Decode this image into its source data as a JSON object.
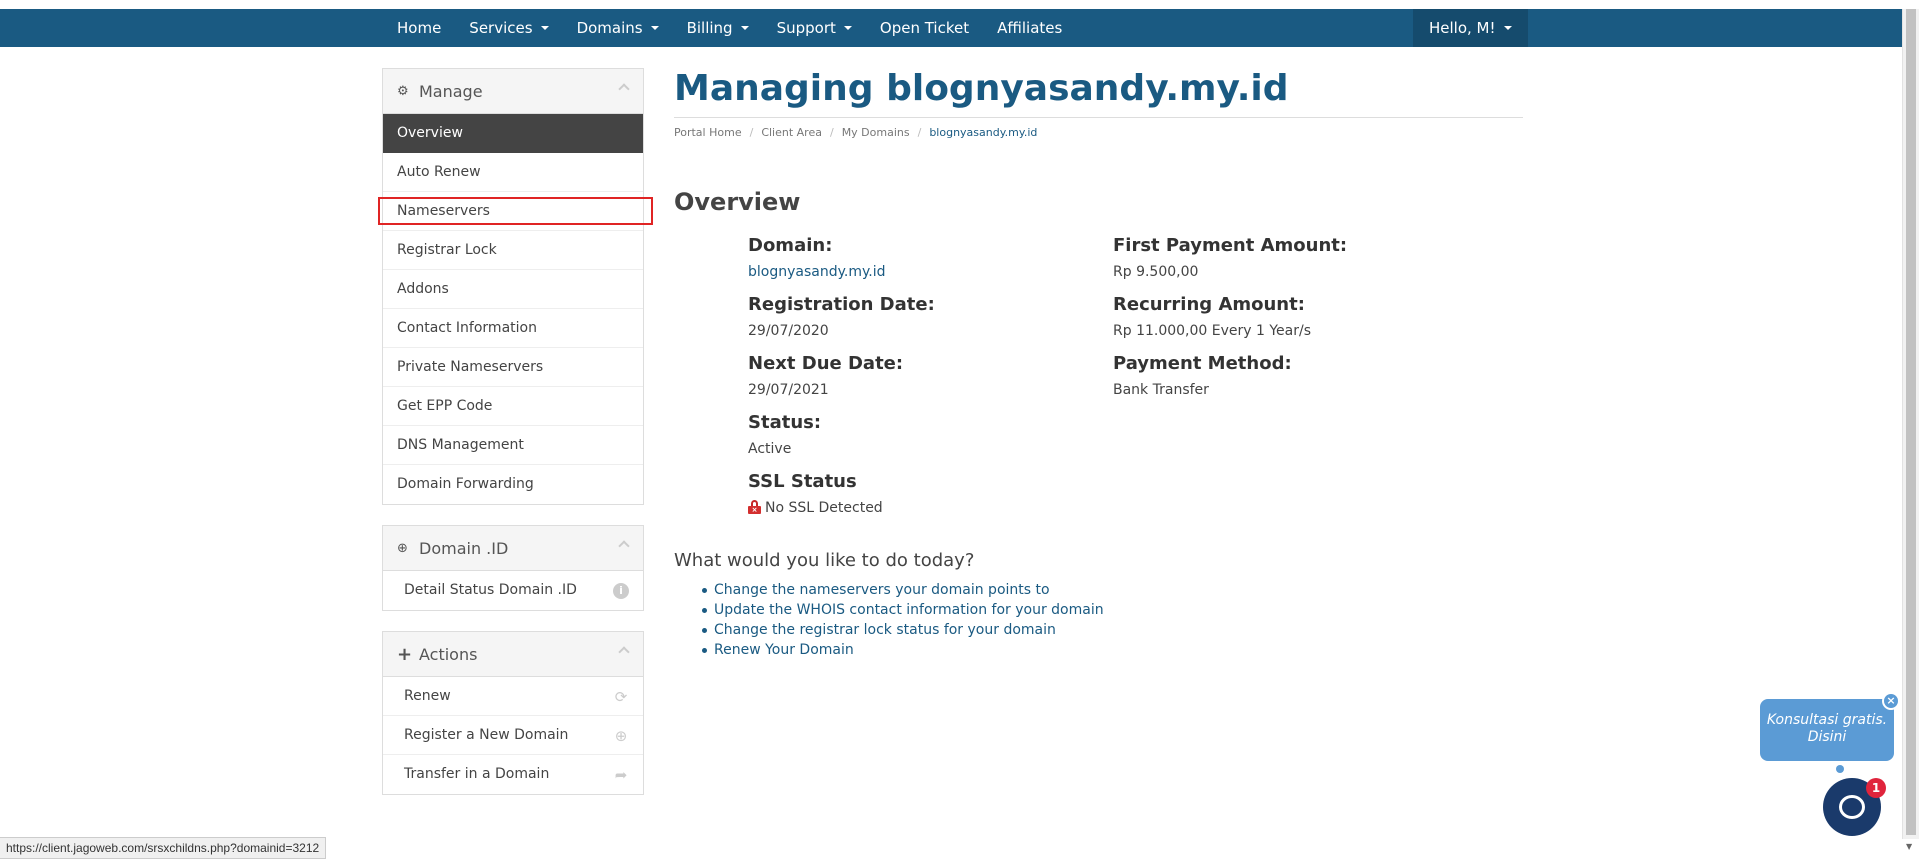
{
  "nav": {
    "items": [
      {
        "label": "Home",
        "dropdown": false
      },
      {
        "label": "Services",
        "dropdown": true
      },
      {
        "label": "Domains",
        "dropdown": true
      },
      {
        "label": "Billing",
        "dropdown": true
      },
      {
        "label": "Support",
        "dropdown": true
      },
      {
        "label": "Open Ticket",
        "dropdown": false
      },
      {
        "label": "Affiliates",
        "dropdown": false
      }
    ],
    "user": "Hello, M!"
  },
  "sidebar": {
    "manage": {
      "title": "Manage",
      "items": [
        "Overview",
        "Auto Renew",
        "Nameservers",
        "Registrar Lock",
        "Addons",
        "Contact Information",
        "Private Nameservers",
        "Get EPP Code",
        "DNS Management",
        "Domain Forwarding"
      ]
    },
    "domain_id": {
      "title": "Domain .ID",
      "items": [
        "Detail Status Domain .ID"
      ]
    },
    "actions": {
      "title": "Actions",
      "items": [
        "Renew",
        "Register a New Domain",
        "Transfer in a Domain"
      ]
    }
  },
  "main": {
    "title": "Managing blognyasandy.my.id",
    "breadcrumb": [
      "Portal Home",
      "Client Area",
      "My Domains",
      "blognyasandy.my.id"
    ],
    "section": "Overview",
    "fields": {
      "domain_label": "Domain:",
      "domain_value": "blognyasandy.my.id",
      "reg_label": "Registration Date:",
      "reg_value": "29/07/2020",
      "due_label": "Next Due Date:",
      "due_value": "29/07/2021",
      "status_label": "Status:",
      "status_value": "Active",
      "ssl_label": "SSL Status",
      "ssl_value": "No SSL Detected",
      "first_label": "First Payment Amount:",
      "first_value": "Rp 9.500,00",
      "recurring_label": "Recurring Amount:",
      "recurring_value": "Rp 11.000,00 Every 1 Year/s",
      "method_label": "Payment Method:",
      "method_value": "Bank Transfer"
    },
    "todo_title": "What would you like to do today?",
    "todo_links": [
      "Change the nameservers your domain points to",
      "Update the WHOIS contact information for your domain",
      "Change the registrar lock status for your domain",
      "Renew Your Domain"
    ]
  },
  "statusbar": "https://client.jagoweb.com/srsxchildns.php?domainid=3212",
  "chat": {
    "bubble": "Konsultasi gratis. Disini",
    "badge": "1"
  },
  "colors": {
    "nav_bg": "#1a5a82",
    "active_item": "#444444",
    "link": "#1a5a82",
    "highlight": "#e02424"
  }
}
